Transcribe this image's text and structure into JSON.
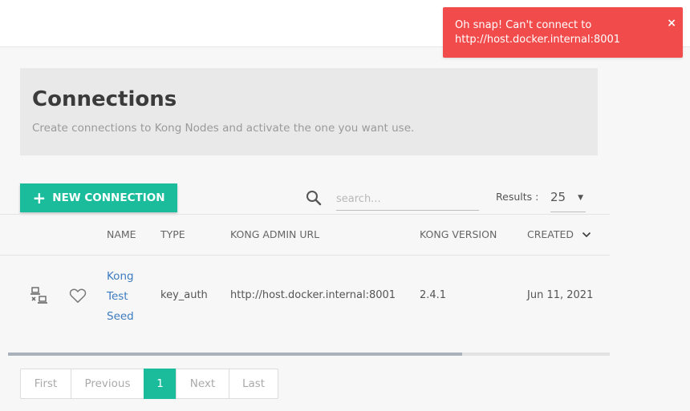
{
  "toast": {
    "message": "Oh snap! Can't connect to http://host.docker.internal:8001",
    "close": "×",
    "color": "#f24b4b"
  },
  "header": {
    "title": "Connections",
    "subtitle": "Create connections to Kong Nodes and activate the one you want use."
  },
  "toolbar": {
    "new_connection_icon": "+",
    "new_connection_label": "NEW CONNECTION",
    "search_placeholder": "search...",
    "results_label": "Results :",
    "results_value": "25",
    "results_caret": "▼"
  },
  "table": {
    "columns": {
      "name": "NAME",
      "type": "TYPE",
      "url": "KONG ADMIN URL",
      "version": "KONG VERSION",
      "created": "CREATED",
      "sort_icon": "chevron-down-icon"
    },
    "rows": [
      {
        "name": "Kong Test Seed",
        "type": "key_auth",
        "url": "http://host.docker.internal:8001",
        "version": "2.4.1",
        "created": "Jun 11, 2021",
        "status_icon": "disconnected-computer-icon",
        "favorite_icon": "heart-outline-icon"
      }
    ]
  },
  "pagination": {
    "first": "First",
    "previous": "Previous",
    "current": "1",
    "next": "Next",
    "last": "Last"
  },
  "colors": {
    "accent": "#1abc9c",
    "link": "#3c7bc0",
    "error": "#f24b4b"
  }
}
